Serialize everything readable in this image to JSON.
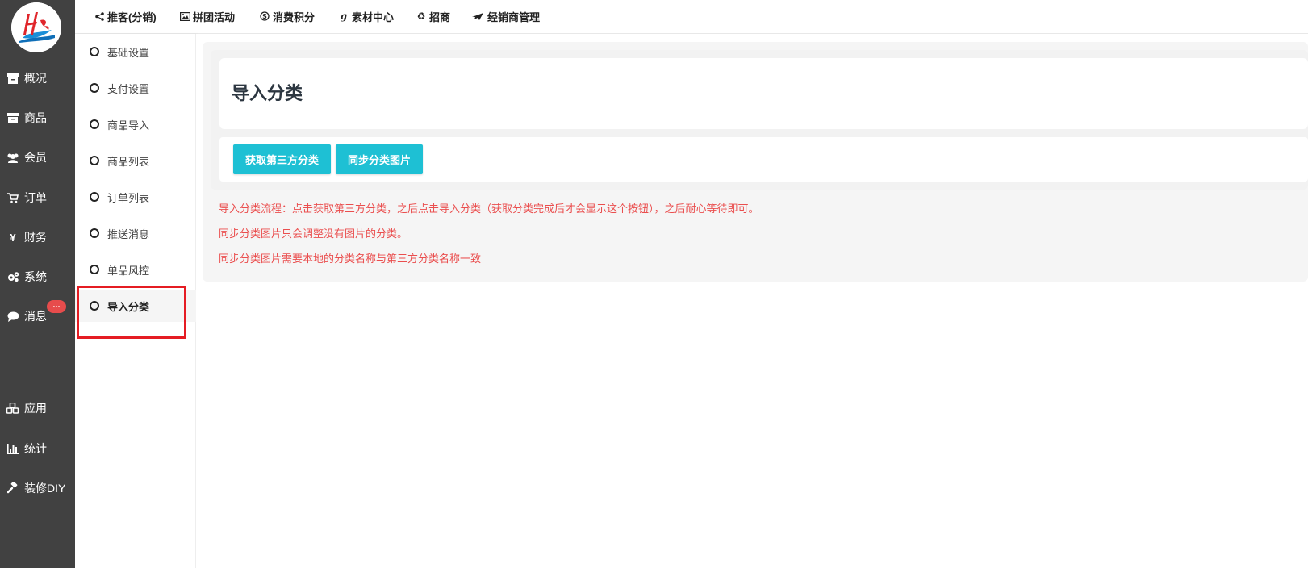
{
  "colors": {
    "sidebar_bg": "#414141",
    "accent_button": "#1ec0d4",
    "note_red": "#ea4e4e",
    "badge_red": "#e74c4c",
    "highlight_border": "#e51c23"
  },
  "sidebar": {
    "items": [
      {
        "label": "概况",
        "icon": "archive-icon"
      },
      {
        "label": "商品",
        "icon": "archive-icon"
      },
      {
        "label": "会员",
        "icon": "users-icon"
      },
      {
        "label": "订单",
        "icon": "cart-icon"
      },
      {
        "label": "财务",
        "icon": "yen-icon"
      },
      {
        "label": "系统",
        "icon": "gears-icon"
      },
      {
        "label": "消息",
        "icon": "chat-icon",
        "badge": "..."
      },
      {
        "label": "应用",
        "icon": "cubes-icon"
      },
      {
        "label": "统计",
        "icon": "bar-chart-icon"
      },
      {
        "label": "装修DIY",
        "icon": "gavel-icon"
      }
    ]
  },
  "topnav": {
    "items": [
      {
        "label": "推客(分销)",
        "icon": "share-icon"
      },
      {
        "label": "拼团活动",
        "icon": "image-icon"
      },
      {
        "label": "消费积分",
        "icon": "skype-icon"
      },
      {
        "label": "素材中心",
        "icon": "gittip-icon"
      },
      {
        "label": "招商",
        "icon": "recycle-icon"
      },
      {
        "label": "经销商管理",
        "icon": "plane-icon"
      }
    ]
  },
  "subnav": {
    "items": [
      {
        "label": "基础设置"
      },
      {
        "label": "支付设置"
      },
      {
        "label": "商品导入"
      },
      {
        "label": "商品列表"
      },
      {
        "label": "订单列表"
      },
      {
        "label": "推送消息"
      },
      {
        "label": "单品风控"
      },
      {
        "label": "导入分类",
        "active": true
      }
    ]
  },
  "main": {
    "title": "导入分类",
    "buttons": {
      "fetch": "获取第三方分类",
      "sync": "同步分类图片"
    },
    "notes": [
      "导入分类流程：点击获取第三方分类，之后点击导入分类（获取分类完成后才会显示这个按钮），之后耐心等待即可。",
      "同步分类图片只会调整没有图片的分类。",
      "同步分类图片需要本地的分类名称与第三方分类名称一致"
    ]
  }
}
